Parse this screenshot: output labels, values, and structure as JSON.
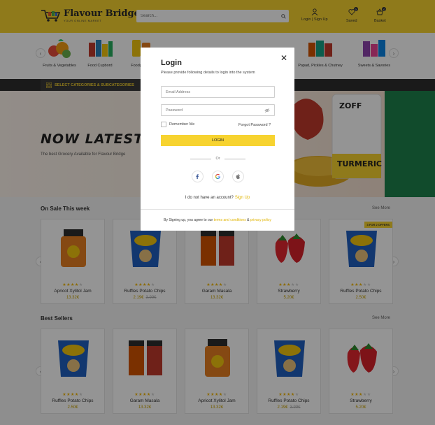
{
  "header": {
    "logo_title": "Flavour Bridge",
    "logo_subtitle": "YOUR ONLINE MARKET",
    "search_placeholder": "Search...",
    "login_label": "Login | Sign Up",
    "saved_label": "Saved",
    "saved_count": "0",
    "basket_label": "Basket",
    "basket_count": "0",
    "accent_color": "#f7d330"
  },
  "categories": [
    {
      "label": "Fruits & Vegetables",
      "icon": "fruits-vegetables-thumb"
    },
    {
      "label": "Food Cupbord",
      "icon": "food-cupboard-thumb"
    },
    {
      "label": "Foodgrains",
      "icon": "foodgrains-thumb"
    },
    {
      "label": "",
      "icon": "category-thumb"
    },
    {
      "label": "",
      "icon": "category-thumb"
    },
    {
      "label": "",
      "icon": "category-thumb"
    },
    {
      "label": "",
      "icon": "category-thumb"
    },
    {
      "label": "Papad, Pickles & Chutney",
      "icon": "pickles-thumb"
    },
    {
      "label": "Sweets & Savories",
      "icon": "sweets-thumb"
    }
  ],
  "category_bar": {
    "label": "SELECT CATEGORIES & SUBCATEGORIES"
  },
  "hero": {
    "title": "NOW LATEST",
    "subtitle": "The best Grocery Available for Flavour Bridge",
    "product_brand": "ZOFF",
    "product_name": "TURMERIC"
  },
  "on_sale": {
    "title": "On Sale This week",
    "see_more": "See More",
    "products": [
      {
        "name": "Apricot Xylitol Jam",
        "price": "13.32€",
        "old_price": "",
        "rating": 4,
        "offer": ""
      },
      {
        "name": "Ruffles Potato Chips",
        "price": "2.19€",
        "old_price": "3.99€",
        "rating": 4,
        "offer": ""
      },
      {
        "name": "Garam Masala",
        "price": "13.32€",
        "old_price": "",
        "rating": 4,
        "offer": ""
      },
      {
        "name": "Strawberry",
        "price": "5.20€",
        "old_price": "",
        "rating": 3,
        "offer": ""
      },
      {
        "name": "Ruffles Potato Chips",
        "price": "2.50€",
        "old_price": "",
        "rating": 3,
        "offer": "3 FOR 2 OFFERS"
      }
    ]
  },
  "best_sellers": {
    "title": "Best Sellers",
    "see_more": "See More",
    "products": [
      {
        "name": "Ruffles Potato Chips",
        "price": "2.50€",
        "old_price": "",
        "rating": 4
      },
      {
        "name": "Garam Masala",
        "price": "13.32€",
        "old_price": "",
        "rating": 4
      },
      {
        "name": "Apricot Xylitol Jam",
        "price": "13.32€",
        "old_price": "",
        "rating": 4
      },
      {
        "name": "Ruffles Potato Chips",
        "price": "2.19€",
        "old_price": "3.99€",
        "rating": 4
      },
      {
        "name": "Strawberry",
        "price": "5.20€",
        "old_price": "",
        "rating": 3
      }
    ]
  },
  "modal": {
    "title": "Login",
    "description": "Please provide following details to login into the system",
    "email_placeholder": "Email Address",
    "password_placeholder": "Password",
    "remember_label": "Remember Me",
    "forgot_label": "Forgot Password ?",
    "login_button": "LOGIN",
    "or_label": "Or",
    "no_account_text": "I do not have an account?",
    "signup_link": "Sign Up",
    "terms_prefix": "By Signing up, you agree to our",
    "terms_link": "terms and conditions",
    "terms_and": "&",
    "privacy_link": "privacy policy"
  }
}
